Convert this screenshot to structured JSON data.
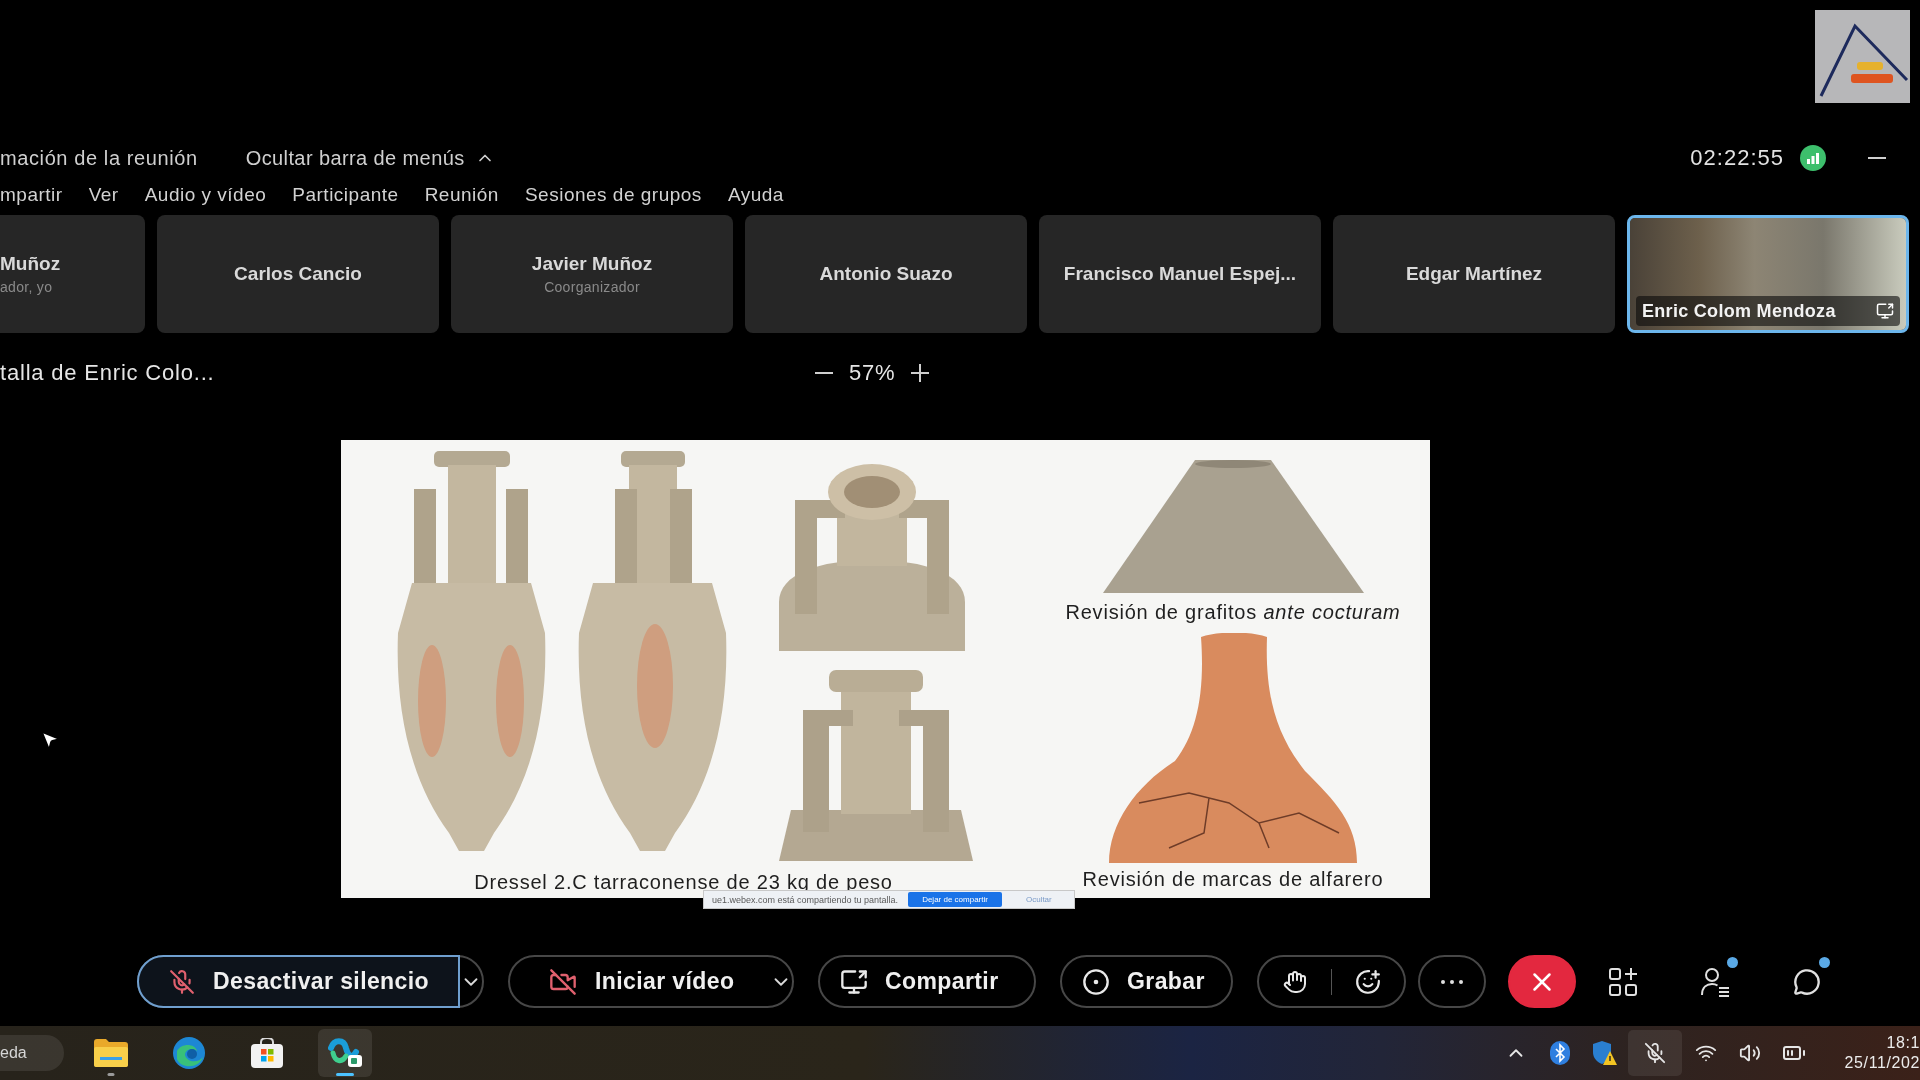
{
  "meeting_bar": {
    "info": "mación de la reunión",
    "hide_menu": "Ocultar barra de menús",
    "timer": "02:22:55"
  },
  "menu": [
    "mpartir",
    "Ver",
    "Audio y vídeo",
    "Participante",
    "Reunión",
    "Sesiones de grupos",
    "Ayuda"
  ],
  "participants": [
    {
      "kind": "tile",
      "name": "Muñoz",
      "role": "ador, yo",
      "active_speaker": false
    },
    {
      "kind": "tile",
      "name": "Carlos Cancio",
      "active_speaker": false
    },
    {
      "kind": "tile",
      "name": "Javier Muñoz",
      "role": "Coorganizador",
      "active_speaker": false
    },
    {
      "kind": "tile",
      "name": "Antonio Suazo",
      "active_speaker": false
    },
    {
      "kind": "tile",
      "name": "Francisco Manuel Espej...",
      "active_speaker": false
    },
    {
      "kind": "tile",
      "name": "Edgar Martínez",
      "active_speaker": false
    },
    {
      "kind": "video",
      "name": "Enric Colom Mendoza",
      "active_speaker": true,
      "sharing": true
    }
  ],
  "share_view": {
    "title": "talla de Enric Colo...",
    "zoom": "57%"
  },
  "slide": {
    "left_caption": "Dressel 2.C tarraconense de 23 kg de peso",
    "right_top_caption": "Revisión de grafitos *ante cocturam*",
    "right_bottom_caption": "Revisión de marcas de alfarero"
  },
  "share_notice": {
    "text": "ue1.webex.com está compartiendo tu pantalla.",
    "buttons": [
      {
        "label": "Dejar de compartir",
        "primary": true
      },
      {
        "label": "Ocultar",
        "primary": false
      }
    ]
  },
  "controls": [
    {
      "kind": "mute",
      "label": "Desactivar silencio",
      "focused": true
    },
    {
      "kind": "video",
      "label": "Iniciar vídeo",
      "focused": false
    },
    {
      "kind": "share",
      "label": "Compartir",
      "focused": false
    },
    {
      "kind": "record",
      "label": "Grabar",
      "focused": false
    },
    {
      "kind": "reactions",
      "focused": false
    },
    {
      "kind": "more",
      "focused": false
    },
    {
      "kind": "end",
      "focused": false
    }
  ],
  "panel_buttons": [
    {
      "kind": "layout",
      "notification": false
    },
    {
      "kind": "participants",
      "notification": true
    },
    {
      "kind": "chat",
      "notification": true
    }
  ],
  "taskbar": {
    "search": {
      "placeholder": "eda"
    },
    "apps": [
      {
        "kind": "explorer",
        "running": true,
        "active": false
      },
      {
        "kind": "edge",
        "running": false,
        "active": false
      },
      {
        "kind": "store",
        "running": false,
        "active": false
      },
      {
        "kind": "webex",
        "running": true,
        "active": true
      }
    ],
    "tray": [
      {
        "kind": "overflow",
        "highlighted": false
      },
      {
        "kind": "bluetooth",
        "highlighted": false
      },
      {
        "kind": "security",
        "highlighted": false
      },
      {
        "kind": "mic_off",
        "highlighted": true
      },
      {
        "kind": "wifi",
        "highlighted": false
      },
      {
        "kind": "volume",
        "highlighted": false
      },
      {
        "kind": "battery",
        "highlighted": false
      }
    ],
    "time": "18:1",
    "date": "25/11/202"
  }
}
